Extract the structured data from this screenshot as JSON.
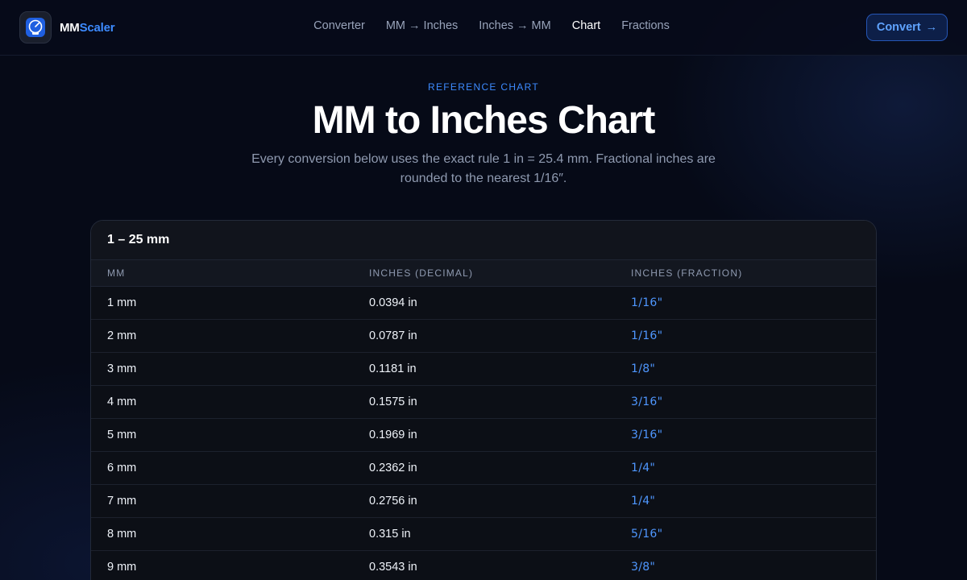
{
  "brand": {
    "part1": "MM",
    "part2": "Scaler"
  },
  "nav": [
    {
      "label": "Converter",
      "active": false
    },
    {
      "label": "MM → Inches",
      "active": false
    },
    {
      "label": "Inches → MM",
      "active": false
    },
    {
      "label": "Chart",
      "active": true
    },
    {
      "label": "Fractions",
      "active": false
    }
  ],
  "cta": {
    "label": "Convert",
    "arrow": "→"
  },
  "hero": {
    "eyebrow": "REFERENCE CHART",
    "title": "MM to Inches Chart",
    "subtitle": "Every conversion below uses the exact rule 1 in = 25.4 mm. Fractional inches are rounded to the nearest 1/16″."
  },
  "table": {
    "title": "1 – 25 mm",
    "columns": [
      "MM",
      "INCHES (DECIMAL)",
      "INCHES (FRACTION)"
    ],
    "rows": [
      [
        "1 mm",
        "0.0394 in",
        "1/16\""
      ],
      [
        "2 mm",
        "0.0787 in",
        "1/16\""
      ],
      [
        "3 mm",
        "0.1181 in",
        "1/8\""
      ],
      [
        "4 mm",
        "0.1575 in",
        "3/16\""
      ],
      [
        "5 mm",
        "0.1969 in",
        "3/16\""
      ],
      [
        "6 mm",
        "0.2362 in",
        "1/4\""
      ],
      [
        "7 mm",
        "0.2756 in",
        "1/4\""
      ],
      [
        "8 mm",
        "0.315 in",
        "5/16\""
      ],
      [
        "9 mm",
        "0.3543 in",
        "3/8\""
      ]
    ]
  },
  "colors": {
    "accent": "#3d8bff",
    "background": "#060a17",
    "card": "#0c0f16"
  }
}
